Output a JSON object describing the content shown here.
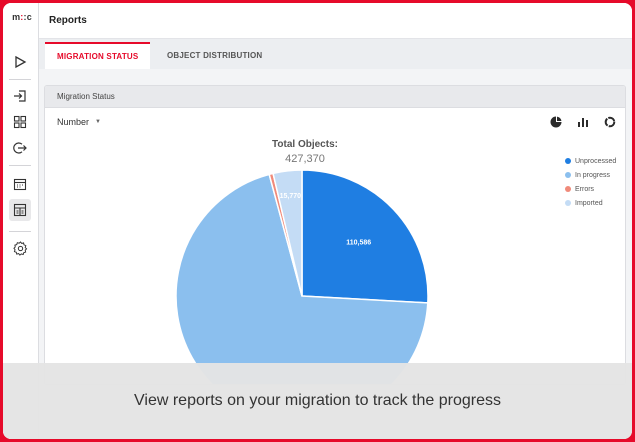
{
  "app": {
    "logo": "m:c",
    "page_title": "Reports"
  },
  "tabs": [
    {
      "label": "MIGRATION STATUS",
      "active": true
    },
    {
      "label": "OBJECT DISTRIBUTION",
      "active": false
    }
  ],
  "card": {
    "title": "Migration Status",
    "metric_select": "Number"
  },
  "toolbar_icons": [
    "pie-chart-icon",
    "bar-chart-icon",
    "donut-chart-icon"
  ],
  "sidebar_icons": [
    "play-icon",
    "import-icon",
    "grid-icon",
    "logout-icon",
    "calendar-icon",
    "report-icon",
    "settings-icon"
  ],
  "chart_data": {
    "type": "pie",
    "title": "Total Objects:",
    "total": "427,370",
    "series": [
      {
        "name": "Unprocessed",
        "value": 110586,
        "label": "110,586",
        "color": "#1f7ee2"
      },
      {
        "name": "In progress",
        "value": 298864,
        "label": "",
        "color": "#8bbfee"
      },
      {
        "name": "Errors",
        "value": 2150,
        "label": "",
        "color": "#f08a7a"
      },
      {
        "name": "Imported",
        "value": 15770,
        "label": "15,770",
        "color": "#c4dcf5"
      }
    ],
    "legend_position": "right"
  },
  "caption": "View reports on your migration to track the progress"
}
